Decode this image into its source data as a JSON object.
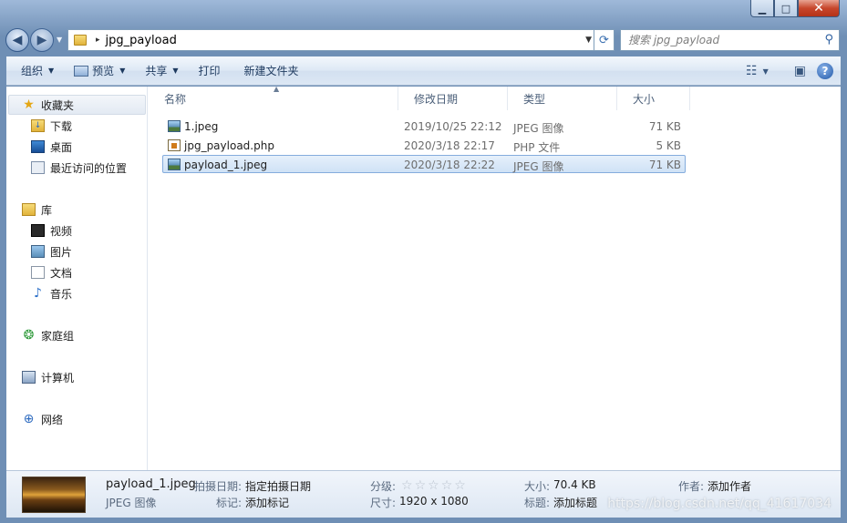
{
  "window": {
    "caption": {
      "minimize": "▁",
      "maximize": "□",
      "close": "✕"
    }
  },
  "nav": {
    "back": "◀",
    "forward": "▶",
    "address_path": "jpg_payload",
    "address_separator": "▸",
    "search_placeholder": "搜索 jpg_payload"
  },
  "toolbar": {
    "organize": "组织",
    "preview": "预览",
    "share": "共享",
    "print": "打印",
    "new_folder": "新建文件夹"
  },
  "sidebar": {
    "favorites": "收藏夹",
    "downloads": "下载",
    "desktop": "桌面",
    "recent": "最近访问的位置",
    "libraries": "库",
    "videos": "视频",
    "pictures": "图片",
    "documents": "文档",
    "music": "音乐",
    "homegroup": "家庭组",
    "computer": "计算机",
    "network": "网络"
  },
  "columns": {
    "name": "名称",
    "date": "修改日期",
    "type": "类型",
    "size": "大小"
  },
  "files": [
    {
      "name": "1.jpeg",
      "date": "2019/10/25 22:12",
      "type": "JPEG 图像",
      "size": "71 KB",
      "icon": "image-icon",
      "selected": false
    },
    {
      "name": "jpg_payload.php",
      "date": "2020/3/18 22:17",
      "type": "PHP 文件",
      "size": "5 KB",
      "icon": "php-file-icon",
      "selected": false
    },
    {
      "name": "payload_1.jpeg",
      "date": "2020/3/18 22:22",
      "type": "JPEG 图像",
      "size": "71 KB",
      "icon": "image-icon",
      "selected": true
    }
  ],
  "details": {
    "filename": "payload_1.jpeg",
    "filetype": "JPEG 图像",
    "shot_date_label": "拍摄日期:",
    "shot_date_value": "指定拍摄日期",
    "tags_label": "标记:",
    "tags_value": "添加标记",
    "rating_label": "分级:",
    "rating": 0,
    "rating_max": 5,
    "dimensions_label": "尺寸:",
    "dimensions_value": "1920 x 1080",
    "size_label": "大小:",
    "size_value": "70.4 KB",
    "title_label": "标题:",
    "title_value": "添加标题",
    "author_label": "作者:",
    "author_value": "添加作者"
  },
  "watermark": "https://blog.csdn.net/qq_41617034"
}
